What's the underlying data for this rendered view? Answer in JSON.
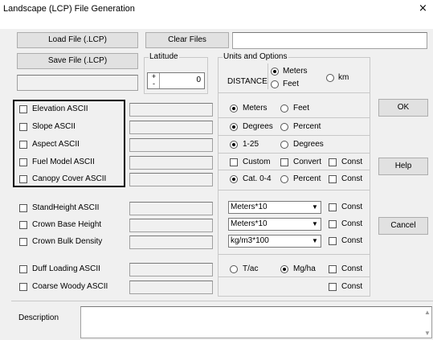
{
  "window": {
    "title": "Landscape (LCP) File Generation",
    "close_glyph": "×"
  },
  "toolbar": {
    "load_label": "Load File (.LCP)",
    "clear_label": "Clear Files",
    "save_label": "Save File (.LCP)",
    "path_value": ""
  },
  "latitude": {
    "label": "Latitude",
    "value": "0"
  },
  "units": {
    "group_label": "Units and Options",
    "distance_label": "DISTANCE",
    "meters": "Meters",
    "feet": "Feet",
    "km": "km"
  },
  "layers": [
    {
      "label": "Elevation ASCII"
    },
    {
      "label": "Slope ASCII"
    },
    {
      "label": "Aspect ASCII"
    },
    {
      "label": "Fuel Model ASCII"
    },
    {
      "label": "Canopy Cover ASCII"
    },
    {
      "label": "StandHeight ASCII"
    },
    {
      "label": "Crown Base Height"
    },
    {
      "label": "Crown Bulk Density"
    },
    {
      "label": "Duff Loading ASCII"
    },
    {
      "label": "Coarse Woody ASCII"
    }
  ],
  "options": {
    "elev_meters": "Meters",
    "elev_feet": "Feet",
    "slope_degrees": "Degrees",
    "slope_percent": "Percent",
    "aspect_125": "1-25",
    "aspect_degrees": "Degrees",
    "fuel_custom": "Custom",
    "fuel_convert": "Convert",
    "const": "Const",
    "canopy_cat": "Cat. 0-4",
    "canopy_percent": "Percent",
    "stand_select": "Meters*10",
    "cbh_select": "Meters*10",
    "cbd_select": "kg/m3*100",
    "duff_tac": "T/ac",
    "duff_mgha": "Mg/ha"
  },
  "actions": {
    "ok": "OK",
    "help": "Help",
    "cancel": "Cancel"
  },
  "description": {
    "label": "Description",
    "value": ""
  }
}
